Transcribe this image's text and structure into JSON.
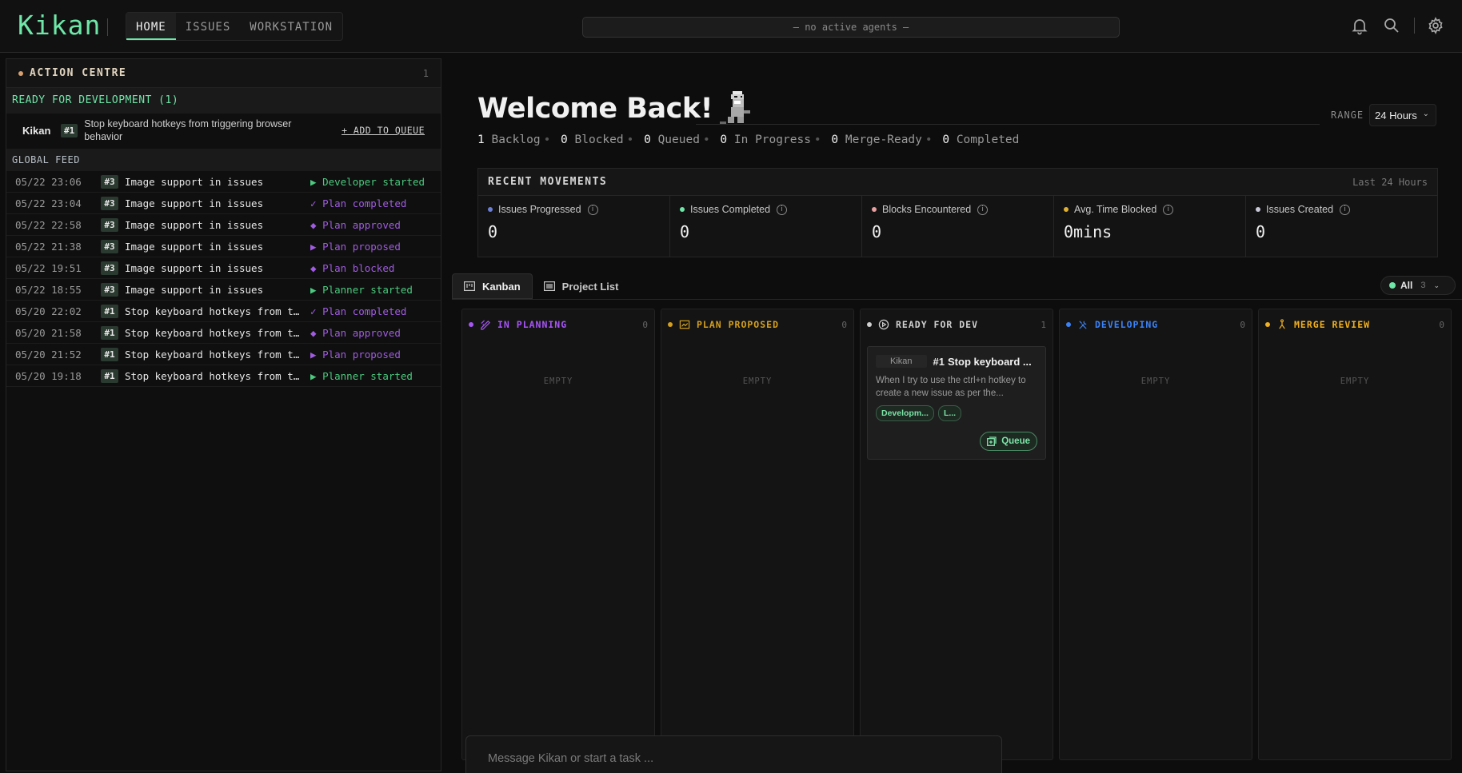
{
  "app": {
    "logo": "Kikan"
  },
  "nav": [
    {
      "label": "HOME",
      "active": true
    },
    {
      "label": "ISSUES",
      "active": false
    },
    {
      "label": "WORKSTATION",
      "active": false
    }
  ],
  "agents_status": "— no active agents —",
  "action_centre": {
    "title": "ACTION CENTRE",
    "count": "1",
    "ready_header": "READY FOR DEVELOPMENT (1)",
    "ready_item": {
      "project": "Kikan",
      "id": "#1",
      "title": "Stop keyboard hotkeys from triggering browser behavior",
      "action": "+ ADD TO QUEUE"
    },
    "feed_header": "GLOBAL FEED",
    "feed": [
      {
        "time": "05/22 23:06",
        "id": "#3",
        "title": "Image support in issues",
        "glyph": "▶",
        "event": "Developer started",
        "color": "#4cc97f"
      },
      {
        "time": "05/22 23:04",
        "id": "#3",
        "title": "Image support in issues",
        "glyph": "✓",
        "event": "Plan completed",
        "color": "#a05ce0"
      },
      {
        "time": "05/22 22:58",
        "id": "#3",
        "title": "Image support in issues",
        "glyph": "◆",
        "event": "Plan approved",
        "color": "#a05ce0"
      },
      {
        "time": "05/22 21:38",
        "id": "#3",
        "title": "Image support in issues",
        "glyph": "▶",
        "event": "Plan proposed",
        "color": "#a05ce0"
      },
      {
        "time": "05/22 19:51",
        "id": "#3",
        "title": "Image support in issues",
        "glyph": "◆",
        "event": "Plan blocked",
        "color": "#a05ce0"
      },
      {
        "time": "05/22 18:55",
        "id": "#3",
        "title": "Image support in issues",
        "glyph": "▶",
        "event": "Planner started",
        "color": "#4cc97f"
      },
      {
        "time": "05/20 22:02",
        "id": "#1",
        "title": "Stop keyboard hotkeys from t…",
        "glyph": "✓",
        "event": "Plan completed",
        "color": "#a05ce0"
      },
      {
        "time": "05/20 21:58",
        "id": "#1",
        "title": "Stop keyboard hotkeys from t…",
        "glyph": "◆",
        "event": "Plan approved",
        "color": "#a05ce0"
      },
      {
        "time": "05/20 21:52",
        "id": "#1",
        "title": "Stop keyboard hotkeys from t…",
        "glyph": "▶",
        "event": "Plan proposed",
        "color": "#a05ce0"
      },
      {
        "time": "05/20 19:18",
        "id": "#1",
        "title": "Stop keyboard hotkeys from t…",
        "glyph": "▶",
        "event": "Planner started",
        "color": "#4cc97f"
      }
    ]
  },
  "welcome": "Welcome Back!",
  "range": {
    "label": "RANGE",
    "value": "24 Hours"
  },
  "stats": [
    {
      "count": "1",
      "label": "Backlog"
    },
    {
      "count": "0",
      "label": "Blocked"
    },
    {
      "count": "0",
      "label": "Queued"
    },
    {
      "count": "0",
      "label": "In Progress"
    },
    {
      "count": "0",
      "label": "Merge-Ready"
    },
    {
      "count": "0",
      "label": "Completed"
    }
  ],
  "recent_movements": {
    "title": "RECENT MOVEMENTS",
    "range": "Last 24 Hours",
    "metrics": [
      {
        "label": "Issues Progressed",
        "value": "0",
        "color": "#6b7fd7"
      },
      {
        "label": "Issues Completed",
        "value": "0",
        "color": "#6ee7a8"
      },
      {
        "label": "Blocks Encountered",
        "value": "0",
        "color": "#e8a0a0"
      },
      {
        "label": "Avg. Time Blocked",
        "value": "0mins",
        "color": "#e0b030"
      },
      {
        "label": "Issues Created",
        "value": "0",
        "color": "#c8c8d8"
      }
    ]
  },
  "tabs": [
    {
      "label": "Kanban",
      "active": true,
      "icon": "kanban-icon"
    },
    {
      "label": "Project List",
      "active": false,
      "icon": "list-icon"
    }
  ],
  "filter": {
    "label": "All",
    "count": "3"
  },
  "columns": [
    {
      "name": "IN PLANNING",
      "count": "0",
      "color": "#a855f7",
      "icon": "pencil-ruler-icon",
      "empty": "EMPTY"
    },
    {
      "name": "PLAN PROPOSED",
      "count": "0",
      "color": "#d4a020",
      "icon": "chart-icon",
      "empty": "EMPTY"
    },
    {
      "name": "READY FOR DEV",
      "count": "1",
      "color": "#d0d0d0",
      "icon": "play-circle-icon",
      "empty": ""
    },
    {
      "name": "DEVELOPING",
      "count": "0",
      "color": "#3b82f6",
      "icon": "tools-icon",
      "empty": "EMPTY"
    },
    {
      "name": "MERGE REVIEW",
      "count": "0",
      "color": "#f0b020",
      "icon": "merge-icon",
      "empty": "EMPTY"
    }
  ],
  "card": {
    "project": "Kikan",
    "id": "#1",
    "title": "Stop keyboard ...",
    "description": "When I try to use the ctrl+n hotkey to create a new issue as per the...",
    "tags": [
      "Developm...",
      "L..."
    ],
    "action": "Queue"
  },
  "message": {
    "placeholder": "Message Kikan or start a task ..."
  }
}
